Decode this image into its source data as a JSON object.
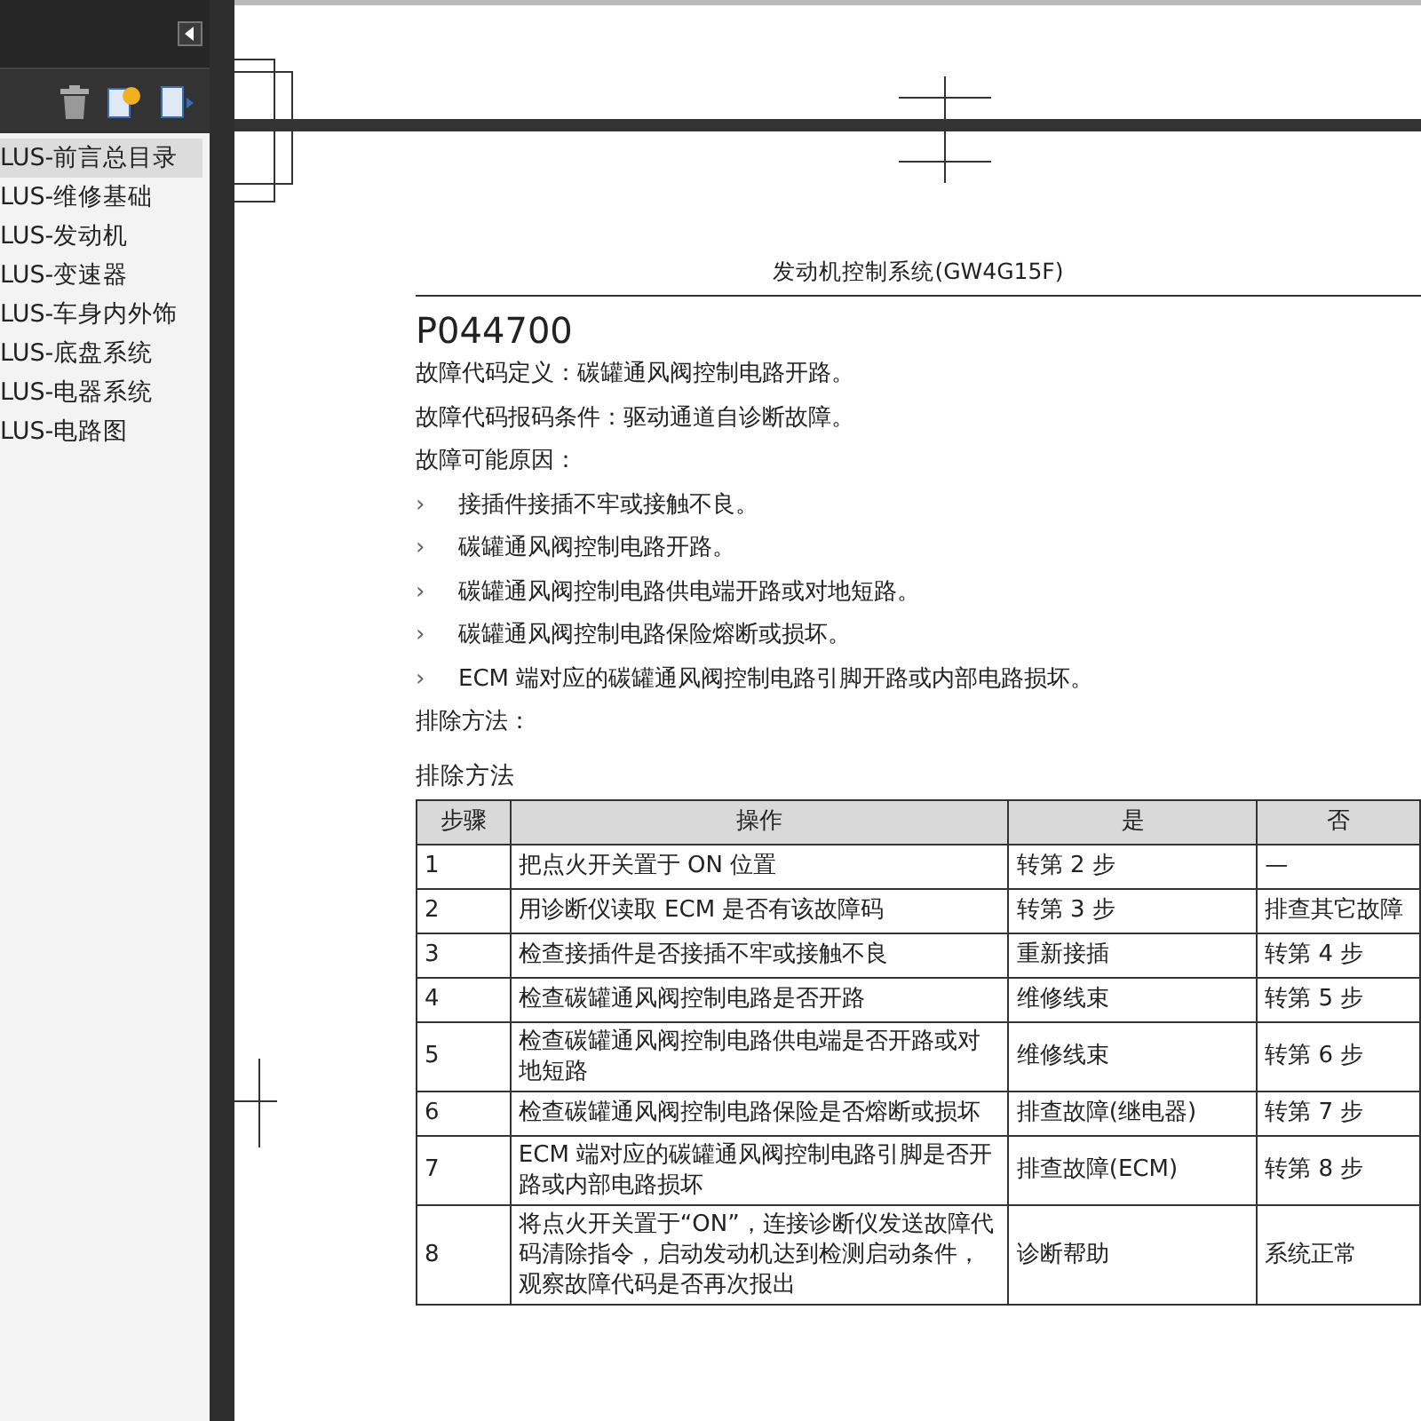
{
  "sidebar": {
    "items": [
      {
        "label": "LUS-前言总目录",
        "selected": true
      },
      {
        "label": "LUS-维修基础",
        "selected": false
      },
      {
        "label": "LUS-发动机",
        "selected": false
      },
      {
        "label": "LUS-变速器",
        "selected": false
      },
      {
        "label": "LUS-车身内外饰",
        "selected": false
      },
      {
        "label": "LUS-底盘系统",
        "selected": false
      },
      {
        "label": "LUS-电器系统",
        "selected": false
      },
      {
        "label": "LUS-电路图",
        "selected": false
      }
    ]
  },
  "document": {
    "header": "发动机控制系统(GW4G15F)",
    "code": "P044700",
    "paragraphs": [
      "故障代码定义：碳罐通风阀控制电路开路。",
      "故障代码报码条件：驱动通道自诊断故障。",
      "故障可能原因："
    ],
    "causes": [
      {
        "bullet": "›",
        "text": "接插件接插不牢或接触不良。"
      },
      {
        "bullet": "›",
        "text": "碳罐通风阀控制电路开路。"
      },
      {
        "bullet": "›",
        "text": "碳罐通风阀控制电路供电端开路或对地短路。"
      },
      {
        "bullet": "›",
        "text": "碳罐通风阀控制电路保险熔断或损坏。"
      },
      {
        "bullet": "›",
        "text": "ECM 端对应的碳罐通风阀控制电路引脚开路或内部电路损坏。"
      }
    ],
    "remedy_label": "排除方法：",
    "table_title": "排除方法",
    "table": {
      "columns": [
        "步骤",
        "操作",
        "是",
        "否"
      ],
      "rows": [
        [
          "1",
          "把点火开关置于 ON 位置",
          "转第 2 步",
          "—"
        ],
        [
          "2",
          "用诊断仪读取 ECM 是否有该故障码",
          "转第 3 步",
          "排查其它故障"
        ],
        [
          "3",
          "检查接插件是否接插不牢或接触不良",
          "重新接插",
          "转第 4 步"
        ],
        [
          "4",
          "检查碳罐通风阀控制电路是否开路",
          "维修线束",
          "转第 5 步"
        ],
        [
          "5",
          "检查碳罐通风阀控制电路供电端是否开路或对地短路",
          "维修线束",
          "转第 6 步"
        ],
        [
          "6",
          "检查碳罐通风阀控制电路保险是否熔断或损坏",
          "排查故障(继电器)",
          "转第 7 步"
        ],
        [
          "7",
          "ECM 端对应的碳罐通风阀控制电路引脚是否开路或内部电路损坏",
          "排查故障(ECM)",
          "转第 8 步"
        ],
        [
          "8",
          "将点火开关置于“ON”，连接诊断仪发送故障代码清除指令，启动发动机达到检测启动条件，观察故障代码是否再次报出",
          "诊断帮助",
          "系统正常"
        ]
      ]
    }
  }
}
